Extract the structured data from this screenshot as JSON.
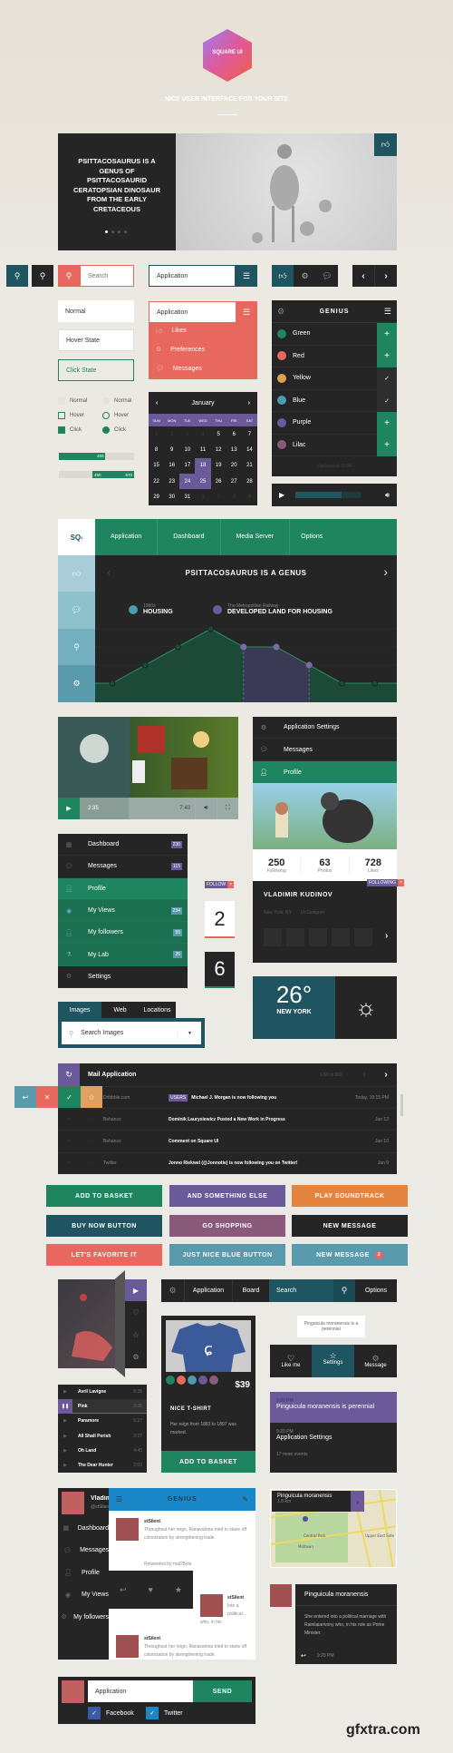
{
  "header": {
    "logo_text": "SQUARE UI",
    "tagline": "NICE USER INTERFACE FOR YOUR SITE"
  },
  "hero": {
    "title": "PSITTACOSAURUS IS A GENUS OF PSITTACOSAURID CERATOPSIAN DINOSAUR FROM THE EARLY CRETACEOUS",
    "slides": 4,
    "active_slide": 1
  },
  "search": {
    "placeholder": "Search"
  },
  "app_input": {
    "value": "Application"
  },
  "inputs": {
    "normal": "Normal",
    "hover": "Hover State",
    "click": "Click State"
  },
  "dropdown": {
    "value": "Application",
    "items": [
      "Likes",
      "Preferences",
      "Messages"
    ]
  },
  "checks": {
    "normal": "Normal",
    "hover": "Hover",
    "click": "Click"
  },
  "progress": [
    {
      "value": "450",
      "percent": 62
    },
    {
      "start": "450",
      "end": "670"
    }
  ],
  "calendar": {
    "month": "January",
    "days": [
      "SUN",
      "MON",
      "TUE",
      "WED",
      "THU",
      "FRI",
      "SAT"
    ],
    "selected": [
      18,
      24,
      25
    ]
  },
  "genius": {
    "title": "GENIUS",
    "items": [
      {
        "label": "Green",
        "color": "#1e8560",
        "state": "add"
      },
      {
        "label": "Red",
        "color": "#e8675f",
        "state": "add"
      },
      {
        "label": "Yellow",
        "color": "#e0a050",
        "state": "check"
      },
      {
        "label": "Blue",
        "color": "#4a9ab0",
        "state": "check"
      },
      {
        "label": "Purple",
        "color": "#6a5a9a",
        "state": "add"
      },
      {
        "label": "Lilac",
        "color": "#8a5a7a",
        "state": "add"
      }
    ],
    "updated": "Updated at 11:04"
  },
  "audio": {
    "progress_percent": 70
  },
  "dash": {
    "logo": "SQ",
    "logo_sup": "2",
    "nav": [
      "Application",
      "Dashboard",
      "Media Server",
      "Options"
    ],
    "title": "PSITTACOSAURUS IS A GENUS",
    "legend": [
      {
        "sub": "1980s",
        "label": "HOUSING"
      },
      {
        "sub": "The Metropolitan Railway",
        "label": "DEVELOPED LAND FOR HOUSING"
      }
    ]
  },
  "chart_data": {
    "type": "area",
    "values": [
      0,
      1,
      2,
      3,
      2,
      2,
      1,
      0,
      0
    ],
    "highlight_range": [
      4,
      6
    ],
    "grid": true
  },
  "video": {
    "current": "2:35",
    "total": "7:40"
  },
  "profile_menu": {
    "items": [
      "Application Settings",
      "Messages",
      "Profile"
    ]
  },
  "profile": {
    "stats": [
      {
        "value": "250",
        "label": "Following"
      },
      {
        "value": "63",
        "label": "Photos"
      },
      {
        "value": "728",
        "label": "Likes"
      }
    ],
    "following_badge": "FOLLOWING",
    "name": "VLADIMIR KUDINOV",
    "location": "New York, NY",
    "role": "UI Designer"
  },
  "sidebar": {
    "items": [
      {
        "label": "Dashboard",
        "count": "230"
      },
      {
        "label": "Messages",
        "count": "115"
      },
      {
        "label": "Profile",
        "count": ""
      },
      {
        "label": "My Views",
        "count": "234"
      },
      {
        "label": "My followers",
        "count": "55"
      },
      {
        "label": "My Lab",
        "count": "26"
      },
      {
        "label": "Settings",
        "count": ""
      }
    ]
  },
  "follow": {
    "label": "FOLLOW",
    "counter1": "2",
    "counter2": "6"
  },
  "weather": {
    "temp": "26°",
    "city": "NEW YORK"
  },
  "image_search": {
    "tabs": [
      "Images",
      "Web",
      "Locations"
    ],
    "placeholder": "Search Images"
  },
  "mail": {
    "title": "Mail Application",
    "range": "1-50 of 300",
    "rows": [
      {
        "from": "Dribbble.com",
        "tag": "USERS",
        "subject": "Michael J. Morgan is now following you",
        "date": "Today, 10:15 PM"
      },
      {
        "from": "Behance",
        "tag": "",
        "subject": "Dominik Laurysiewicz Posted a New Work in Progress",
        "date": "Jan 12"
      },
      {
        "from": "Behance",
        "tag": "",
        "subject": "Comment on Square UI",
        "date": "Jan 10"
      },
      {
        "from": "Twitter",
        "tag": "",
        "subject": "Jonno Riekwel (@Jonnotie) is now following you on Twitter!",
        "date": "Jan 9"
      }
    ]
  },
  "buttons": [
    {
      "label": "ADD TO BASKET",
      "color": "#1e8560"
    },
    {
      "label": "AND SOMETHING ELSE",
      "color": "#6a5a9a"
    },
    {
      "label": "PLAY SOUNDTRACK",
      "color": "#e5843f"
    },
    {
      "label": "BUY NOW BUTTON",
      "color": "#1f5560"
    },
    {
      "label": "GO SHOPPING",
      "color": "#8a5a7a"
    },
    {
      "label": "NEW MESSAGE",
      "color": "#252525"
    },
    {
      "label": "LET'S FAVORITE IT",
      "color": "#e8675f"
    },
    {
      "label": "JUST NICE BLUE BUTTON",
      "color": "#5a9aad"
    },
    {
      "label": "NEW MESSAGE",
      "color": "#5a9aad",
      "badge": "2"
    }
  ],
  "playlist": [
    {
      "artist": "Avril Lavigne",
      "time": "8:35"
    },
    {
      "artist": "Pink",
      "time": "2:35"
    },
    {
      "artist": "Paramore",
      "time": "5:27"
    },
    {
      "artist": "All Shall Perish",
      "time": "3:37"
    },
    {
      "artist": "Oh Land",
      "time": "4:45"
    },
    {
      "artist": "The Dear Hunter",
      "time": "2:50"
    }
  ],
  "navbar": {
    "items": [
      "Application",
      "Board"
    ],
    "search": "Search",
    "options": "Options"
  },
  "product": {
    "price": "$39",
    "name": "NICE T-SHIRT",
    "desc": "Her reign from 1883 to 1897 was marked.",
    "cta": "ADD TO BASKET",
    "swatches": [
      "#1e8560",
      "#e8675f",
      "#4a9ab0",
      "#6a5a9a",
      "#8a5a7a"
    ]
  },
  "tooltip": "Pinguicula moranensis is a perennial",
  "icon_tabs": [
    "Like me",
    "Settings",
    "Message"
  ],
  "events": {
    "time1": "9:20 PM",
    "title1": "Pinguicula moranensis is perennial",
    "time2": "9:20 PM",
    "title2": "Application Settings",
    "more": "17 more events"
  },
  "feed": {
    "user_name": "Vladimir",
    "user_handle": "@stSilent",
    "menu": [
      "Dashboard",
      "Messages",
      "Profile",
      "My Views",
      "My followers"
    ],
    "title": "GENIUS",
    "posts": [
      {
        "user": "stSilent",
        "text": "Throughout her reign, Ranavalona tried to stave off colonization by strengthening trade."
      },
      {
        "user": "stSilent",
        "text": "Into a political... who, in his"
      },
      {
        "user": "stSilent",
        "text": "Throughout her reign, Ranavalona tried to stave off colonization by strengthening trade."
      }
    ],
    "retweet": "Retweeted by maDByte"
  },
  "map": {
    "title": "Pinguicula moranensis",
    "distance": "1.8 km",
    "labels": [
      "Central Park",
      "Midtown",
      "Upper East Side"
    ]
  },
  "comment": {
    "title": "Pinguicula moranensis",
    "text": "She entered into a political marriage with Rainilaiarivony who, in his role as Prime Minister.",
    "time": "9:20 PM"
  },
  "compose": {
    "value": "Application",
    "send": "SEND",
    "facebook": "Facebook",
    "twitter": "Twitter"
  },
  "watermark": "gfxtra.com"
}
